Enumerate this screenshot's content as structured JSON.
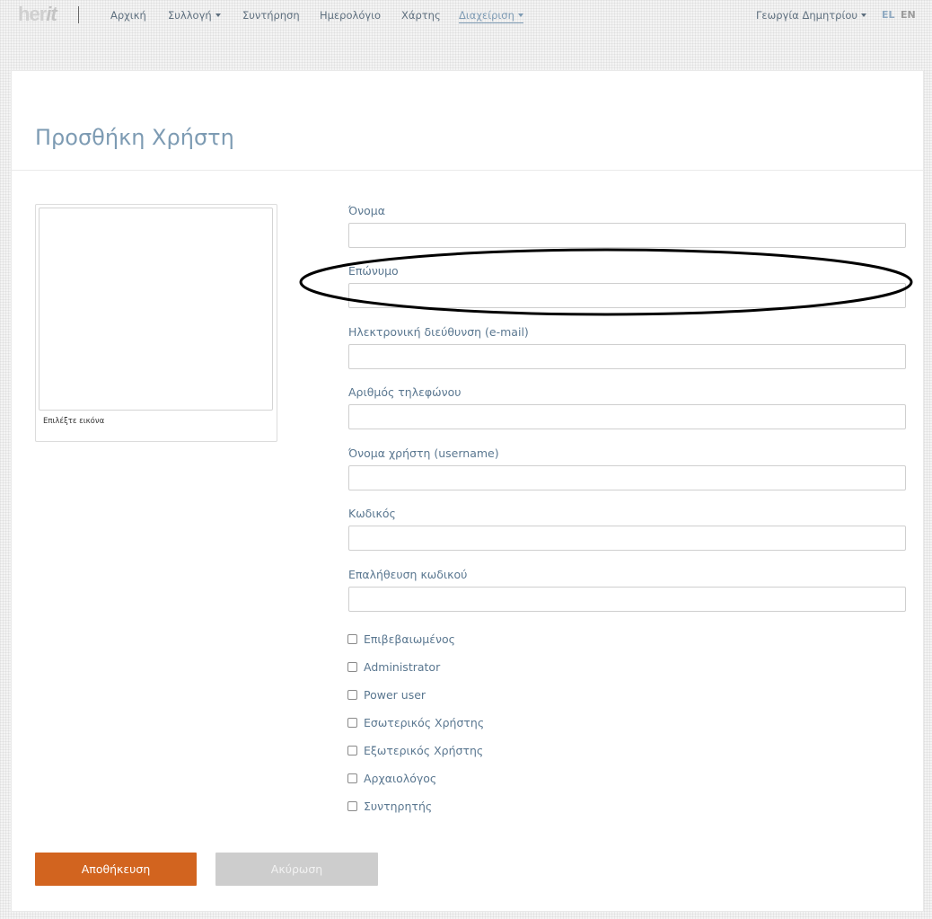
{
  "brand": {
    "logo_main": "her",
    "logo_suffix": "it"
  },
  "nav": {
    "items": [
      {
        "label": "Αρχική",
        "dropdown": false
      },
      {
        "label": "Συλλογή",
        "dropdown": true
      },
      {
        "label": "Συντήρηση",
        "dropdown": false
      },
      {
        "label": "Ημερολόγιο",
        "dropdown": false
      },
      {
        "label": "Χάρτης",
        "dropdown": false
      },
      {
        "label": "Διαχείριση",
        "dropdown": true,
        "active": true
      }
    ],
    "user": "Γεωργία Δημητρίου",
    "lang_el": "EL",
    "lang_en": "EN"
  },
  "page": {
    "title": "Προσθήκη Χρήστη"
  },
  "image_picker": {
    "caption": "Επιλέξτε εικόνα"
  },
  "form": {
    "fields": [
      {
        "label": "Όνομα",
        "value": ""
      },
      {
        "label": "Επώνυμο",
        "value": ""
      },
      {
        "label": "Ηλεκτρονική διεύθυνση (e-mail)",
        "value": ""
      },
      {
        "label": "Αριθμός τηλεφώνου",
        "value": ""
      },
      {
        "label": "Όνομα χρήστη (username)",
        "value": ""
      },
      {
        "label": "Κωδικός",
        "value": ""
      },
      {
        "label": "Επαλήθευση κωδικού",
        "value": ""
      }
    ],
    "checkboxes": [
      {
        "label": "Επιβεβαιωμένος",
        "checked": false
      },
      {
        "label": "Administrator",
        "checked": false
      },
      {
        "label": "Power user",
        "checked": false
      },
      {
        "label": "Εσωτερικός Χρήστης",
        "checked": false
      },
      {
        "label": "Εξωτερικός Χρήστης",
        "checked": false
      },
      {
        "label": "Αρχαιολόγος",
        "checked": false
      },
      {
        "label": "Συντηρητής",
        "checked": false
      }
    ]
  },
  "buttons": {
    "save": "Αποθήκευση",
    "cancel": "Ακύρωση"
  },
  "colors": {
    "accent": "#7d9bb3",
    "label": "#5a7790",
    "save_button": "#d2641f",
    "cancel_button": "#cdcdcd",
    "annotation_ellipse": "#000000"
  }
}
